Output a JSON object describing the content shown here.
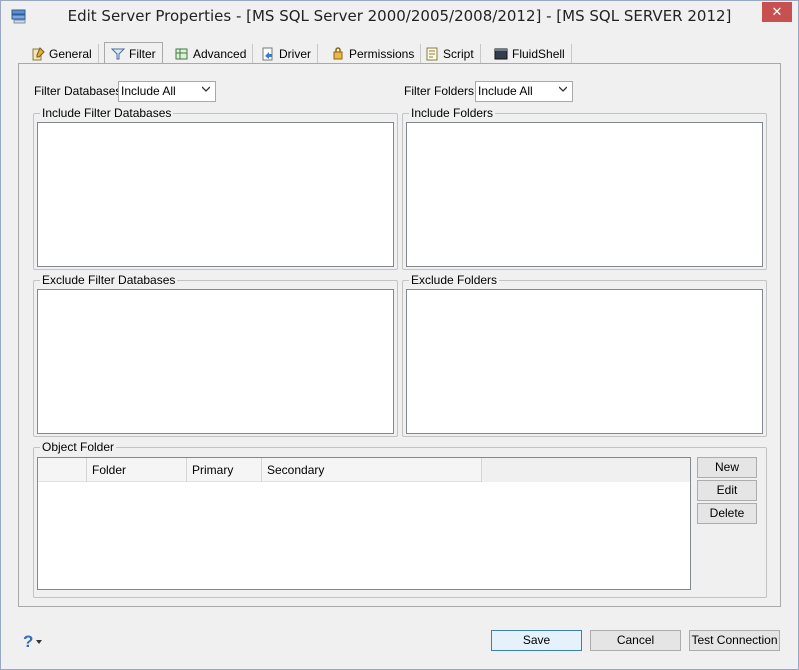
{
  "window": {
    "title": "Edit Server Properties - [MS SQL Server 2000/2005/2008/2012] - [MS SQL SERVER 2012]",
    "close_symbol": "✕"
  },
  "tabs": [
    {
      "label": "General",
      "icon": "general-icon",
      "active": false
    },
    {
      "label": "Filter",
      "icon": "filter-icon",
      "active": true
    },
    {
      "label": "Advanced",
      "icon": "advanced-icon",
      "active": false
    },
    {
      "label": "Driver",
      "icon": "driver-icon",
      "active": false
    },
    {
      "label": "Permissions",
      "icon": "permissions-icon",
      "active": false
    },
    {
      "label": "Script",
      "icon": "script-icon",
      "active": false
    },
    {
      "label": "FluidShell",
      "icon": "fluidshell-icon",
      "active": false
    }
  ],
  "filter": {
    "databases_label": "Filter Databases",
    "databases_value": "Include All",
    "folders_label": "Filter Folders:",
    "folders_value": "Include All"
  },
  "groups": {
    "include_databases": "Include Filter Databases",
    "include_folders": "Include Folders",
    "exclude_databases": "Exclude Filter Databases",
    "exclude_folders": "Exclude Folders",
    "object_folder": "Object Folder"
  },
  "object_folder_table": {
    "columns": [
      "",
      "Folder",
      "Primary",
      "Secondary"
    ],
    "rows": []
  },
  "object_folder_buttons": {
    "new": "New",
    "edit": "Edit",
    "delete": "Delete"
  },
  "footer": {
    "help_symbol": "?",
    "save": "Save",
    "cancel": "Cancel",
    "test_connection": "Test Connection"
  }
}
